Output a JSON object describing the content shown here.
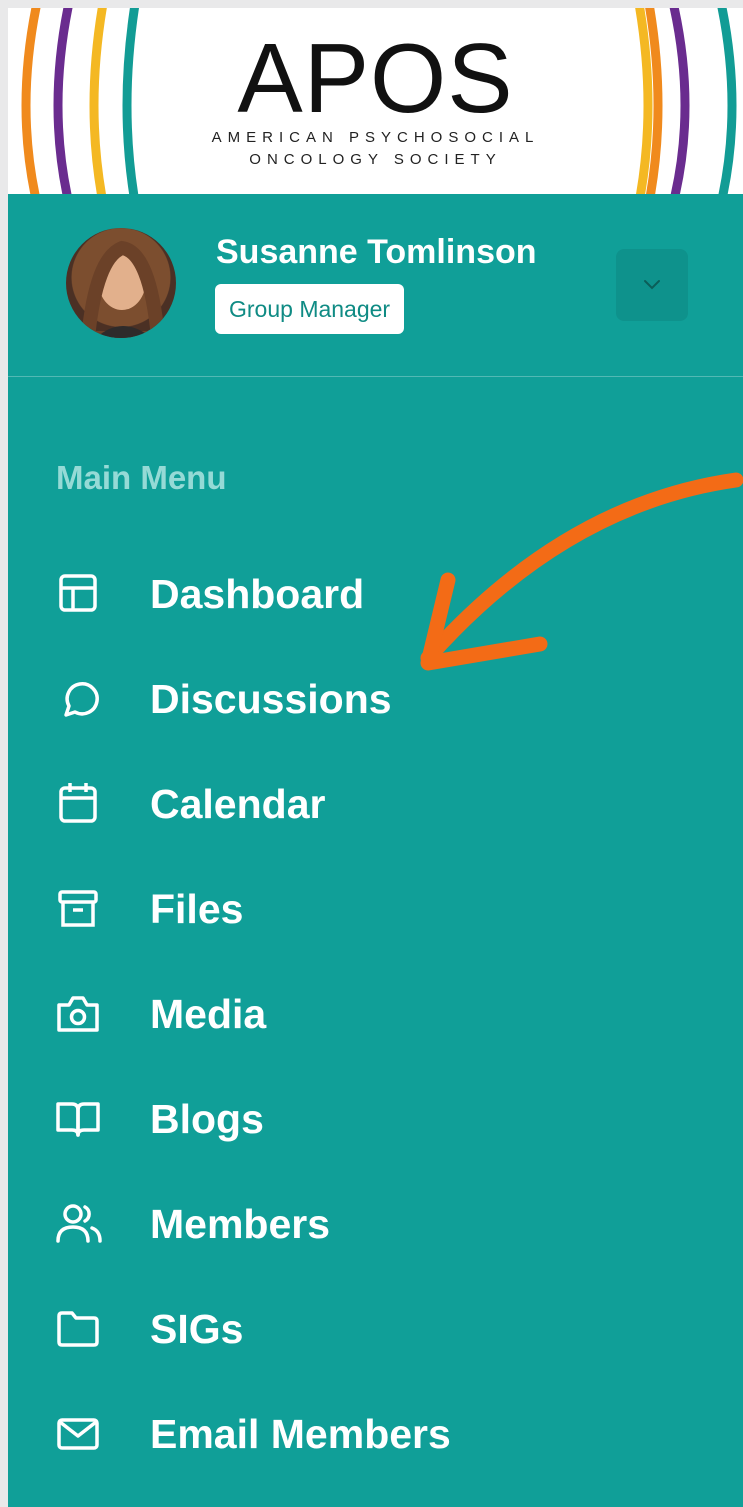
{
  "logo": {
    "title": "APOS",
    "subtitle_line1": "AMERICAN PSYCHOSOCIAL",
    "subtitle_line2": "ONCOLOGY SOCIETY"
  },
  "profile": {
    "name": "Susanne Tomlinson",
    "role": "Group Manager"
  },
  "menu": {
    "heading": "Main Menu",
    "items": [
      {
        "label": "Dashboard",
        "icon": "dashboard-icon"
      },
      {
        "label": "Discussions",
        "icon": "chat-bubble-icon"
      },
      {
        "label": "Calendar",
        "icon": "calendar-icon"
      },
      {
        "label": "Files",
        "icon": "archive-box-icon"
      },
      {
        "label": "Media",
        "icon": "camera-icon"
      },
      {
        "label": "Blogs",
        "icon": "open-book-icon"
      },
      {
        "label": "Members",
        "icon": "users-icon"
      },
      {
        "label": "SIGs",
        "icon": "folder-icon"
      },
      {
        "label": "Email Members",
        "icon": "envelope-icon"
      }
    ]
  },
  "colors": {
    "sidebar": "#109f98",
    "annotation_arrow": "#f36b16"
  }
}
